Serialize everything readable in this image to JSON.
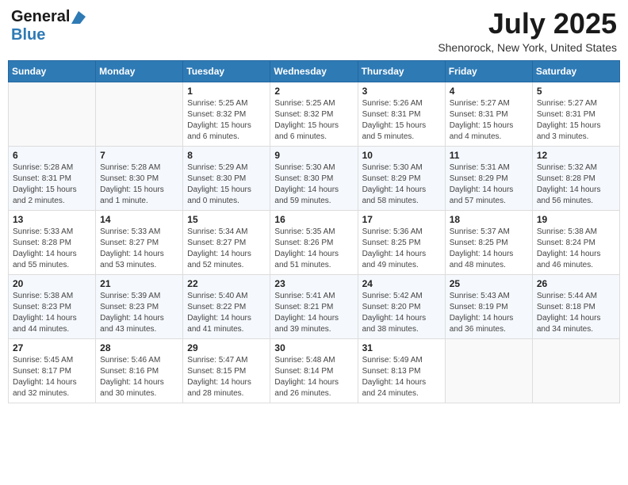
{
  "header": {
    "logo_general": "General",
    "logo_blue": "Blue",
    "month_title": "July 2025",
    "location": "Shenorock, New York, United States"
  },
  "weekdays": [
    "Sunday",
    "Monday",
    "Tuesday",
    "Wednesday",
    "Thursday",
    "Friday",
    "Saturday"
  ],
  "weeks": [
    [
      {
        "day": "",
        "info": ""
      },
      {
        "day": "",
        "info": ""
      },
      {
        "day": "1",
        "info": "Sunrise: 5:25 AM\nSunset: 8:32 PM\nDaylight: 15 hours\nand 6 minutes."
      },
      {
        "day": "2",
        "info": "Sunrise: 5:25 AM\nSunset: 8:32 PM\nDaylight: 15 hours\nand 6 minutes."
      },
      {
        "day": "3",
        "info": "Sunrise: 5:26 AM\nSunset: 8:31 PM\nDaylight: 15 hours\nand 5 minutes."
      },
      {
        "day": "4",
        "info": "Sunrise: 5:27 AM\nSunset: 8:31 PM\nDaylight: 15 hours\nand 4 minutes."
      },
      {
        "day": "5",
        "info": "Sunrise: 5:27 AM\nSunset: 8:31 PM\nDaylight: 15 hours\nand 3 minutes."
      }
    ],
    [
      {
        "day": "6",
        "info": "Sunrise: 5:28 AM\nSunset: 8:31 PM\nDaylight: 15 hours\nand 2 minutes."
      },
      {
        "day": "7",
        "info": "Sunrise: 5:28 AM\nSunset: 8:30 PM\nDaylight: 15 hours\nand 1 minute."
      },
      {
        "day": "8",
        "info": "Sunrise: 5:29 AM\nSunset: 8:30 PM\nDaylight: 15 hours\nand 0 minutes."
      },
      {
        "day": "9",
        "info": "Sunrise: 5:30 AM\nSunset: 8:30 PM\nDaylight: 14 hours\nand 59 minutes."
      },
      {
        "day": "10",
        "info": "Sunrise: 5:30 AM\nSunset: 8:29 PM\nDaylight: 14 hours\nand 58 minutes."
      },
      {
        "day": "11",
        "info": "Sunrise: 5:31 AM\nSunset: 8:29 PM\nDaylight: 14 hours\nand 57 minutes."
      },
      {
        "day": "12",
        "info": "Sunrise: 5:32 AM\nSunset: 8:28 PM\nDaylight: 14 hours\nand 56 minutes."
      }
    ],
    [
      {
        "day": "13",
        "info": "Sunrise: 5:33 AM\nSunset: 8:28 PM\nDaylight: 14 hours\nand 55 minutes."
      },
      {
        "day": "14",
        "info": "Sunrise: 5:33 AM\nSunset: 8:27 PM\nDaylight: 14 hours\nand 53 minutes."
      },
      {
        "day": "15",
        "info": "Sunrise: 5:34 AM\nSunset: 8:27 PM\nDaylight: 14 hours\nand 52 minutes."
      },
      {
        "day": "16",
        "info": "Sunrise: 5:35 AM\nSunset: 8:26 PM\nDaylight: 14 hours\nand 51 minutes."
      },
      {
        "day": "17",
        "info": "Sunrise: 5:36 AM\nSunset: 8:25 PM\nDaylight: 14 hours\nand 49 minutes."
      },
      {
        "day": "18",
        "info": "Sunrise: 5:37 AM\nSunset: 8:25 PM\nDaylight: 14 hours\nand 48 minutes."
      },
      {
        "day": "19",
        "info": "Sunrise: 5:38 AM\nSunset: 8:24 PM\nDaylight: 14 hours\nand 46 minutes."
      }
    ],
    [
      {
        "day": "20",
        "info": "Sunrise: 5:38 AM\nSunset: 8:23 PM\nDaylight: 14 hours\nand 44 minutes."
      },
      {
        "day": "21",
        "info": "Sunrise: 5:39 AM\nSunset: 8:23 PM\nDaylight: 14 hours\nand 43 minutes."
      },
      {
        "day": "22",
        "info": "Sunrise: 5:40 AM\nSunset: 8:22 PM\nDaylight: 14 hours\nand 41 minutes."
      },
      {
        "day": "23",
        "info": "Sunrise: 5:41 AM\nSunset: 8:21 PM\nDaylight: 14 hours\nand 39 minutes."
      },
      {
        "day": "24",
        "info": "Sunrise: 5:42 AM\nSunset: 8:20 PM\nDaylight: 14 hours\nand 38 minutes."
      },
      {
        "day": "25",
        "info": "Sunrise: 5:43 AM\nSunset: 8:19 PM\nDaylight: 14 hours\nand 36 minutes."
      },
      {
        "day": "26",
        "info": "Sunrise: 5:44 AM\nSunset: 8:18 PM\nDaylight: 14 hours\nand 34 minutes."
      }
    ],
    [
      {
        "day": "27",
        "info": "Sunrise: 5:45 AM\nSunset: 8:17 PM\nDaylight: 14 hours\nand 32 minutes."
      },
      {
        "day": "28",
        "info": "Sunrise: 5:46 AM\nSunset: 8:16 PM\nDaylight: 14 hours\nand 30 minutes."
      },
      {
        "day": "29",
        "info": "Sunrise: 5:47 AM\nSunset: 8:15 PM\nDaylight: 14 hours\nand 28 minutes."
      },
      {
        "day": "30",
        "info": "Sunrise: 5:48 AM\nSunset: 8:14 PM\nDaylight: 14 hours\nand 26 minutes."
      },
      {
        "day": "31",
        "info": "Sunrise: 5:49 AM\nSunset: 8:13 PM\nDaylight: 14 hours\nand 24 minutes."
      },
      {
        "day": "",
        "info": ""
      },
      {
        "day": "",
        "info": ""
      }
    ]
  ]
}
